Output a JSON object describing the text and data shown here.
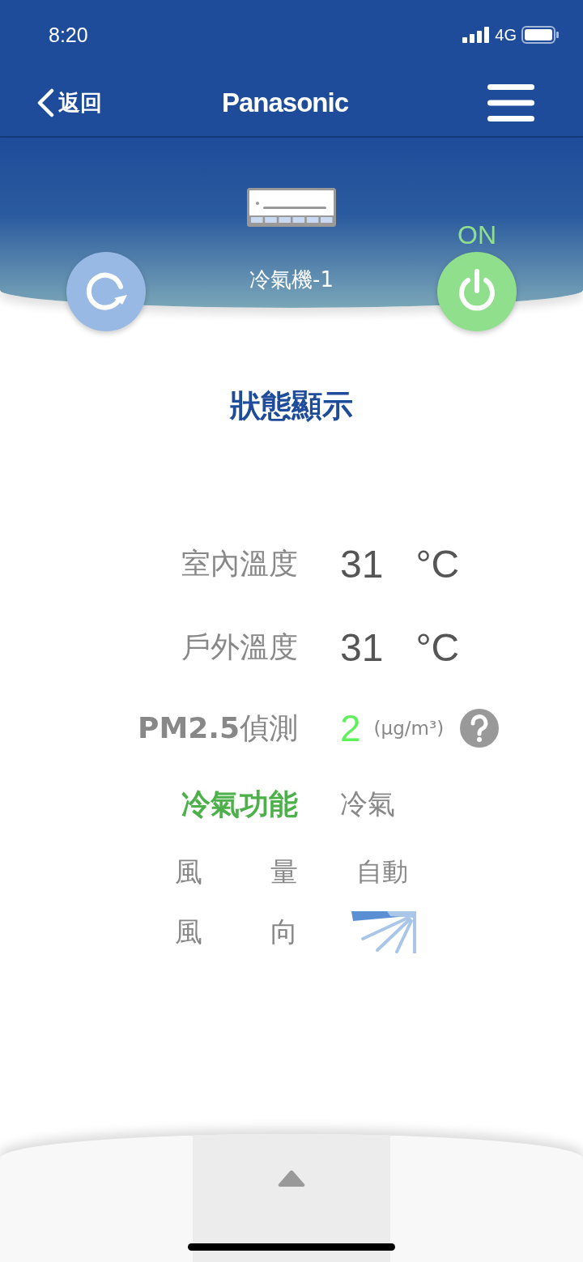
{
  "status_bar": {
    "time": "8:20",
    "network": "4G"
  },
  "nav": {
    "back_label": "返回",
    "brand": "Panasonic"
  },
  "device": {
    "name": "冷氣機-1",
    "power_label": "ON",
    "on": true
  },
  "section_title": "狀態顯示",
  "readings": [
    {
      "kind": "temperature",
      "label": "室內溫度",
      "value": "31",
      "unit": "°C"
    },
    {
      "kind": "temperature",
      "label": "戶外溫度",
      "value": "31",
      "unit": "°C"
    },
    {
      "kind": "pm",
      "label": "**PM2.5**偵測",
      "value": "2",
      "unit": "(µg/m³)"
    },
    {
      "kind": "mode",
      "label": "冷氣功能",
      "value": "冷氣"
    },
    {
      "kind": "fan",
      "label_parts": [
        "風",
        "量"
      ],
      "value": "自動"
    },
    {
      "kind": "direction",
      "label_parts": [
        "風",
        "向"
      ]
    }
  ]
}
